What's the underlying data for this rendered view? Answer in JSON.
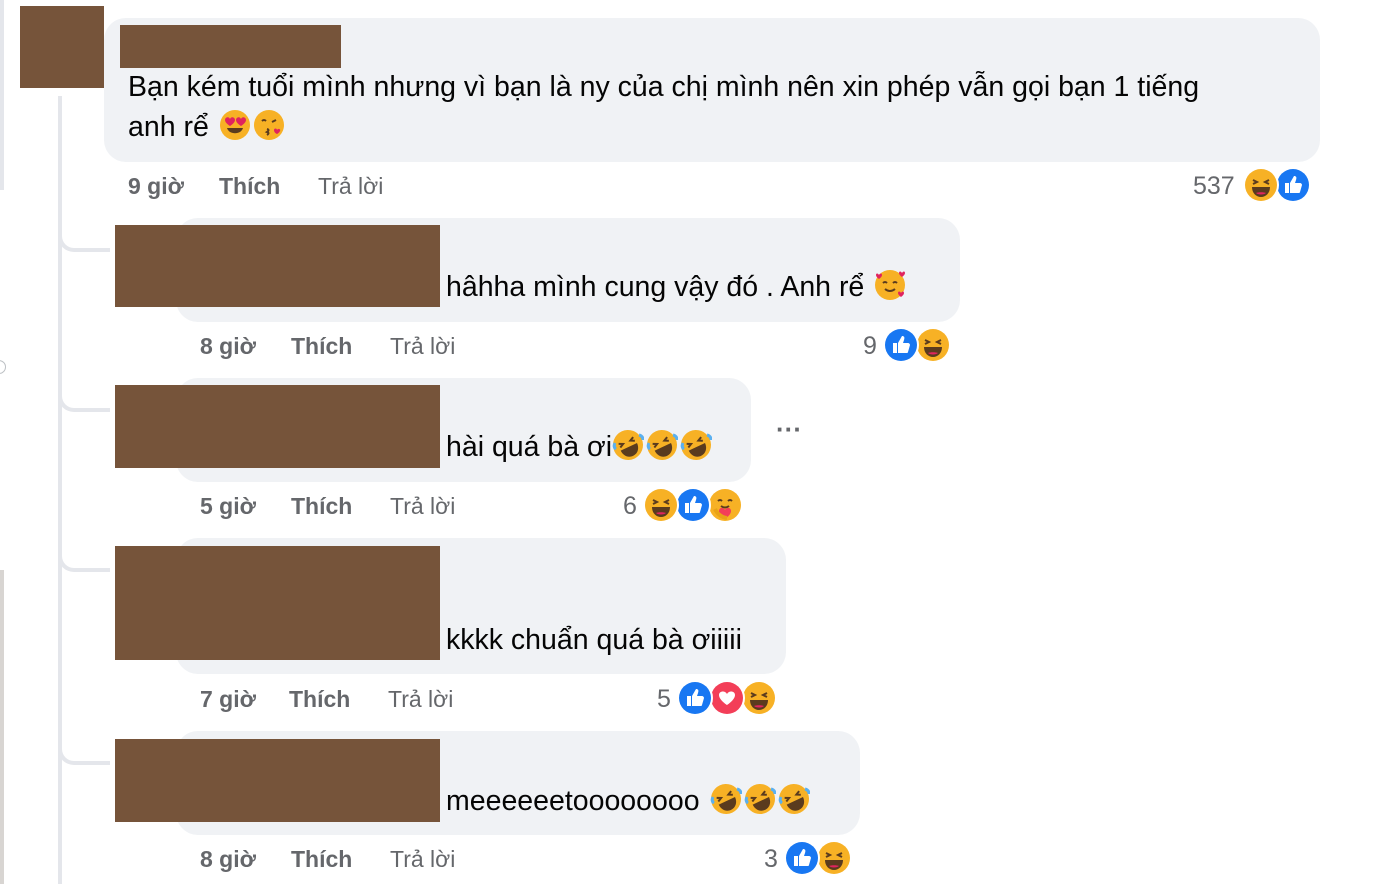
{
  "comment": {
    "text_line1": "Bạn kém tuổi mình nhưng vì bạn là ny của chị mình nên xin phép vẫn gọi bạn 1 tiếng",
    "text_line2": "anh rể",
    "emojis": [
      "heart-eyes-emoji",
      "kissing-heart-emoji"
    ],
    "time": "9 giờ",
    "like_label": "Thích",
    "reply_label": "Trả lời",
    "reaction_count": "537",
    "reactions": [
      "haha",
      "like"
    ]
  },
  "replies": [
    {
      "text": "hâhha mình cung vậy đó . Anh rể",
      "emojis": [
        "smiling-hearts-emoji"
      ],
      "time": "8 giờ",
      "like_label": "Thích",
      "reply_label": "Trả lời",
      "reaction_count": "9",
      "reactions": [
        "like",
        "haha"
      ]
    },
    {
      "text": "hài quá bà ơi",
      "emojis": [
        "rofl-emoji",
        "rofl-emoji",
        "rofl-emoji"
      ],
      "time": "5 giờ",
      "like_label": "Thích",
      "reply_label": "Trả lời",
      "reaction_count": "6",
      "reactions": [
        "haha",
        "like",
        "care"
      ]
    },
    {
      "text": "kkkk chuẩn quá bà ơiiiii",
      "emojis": [],
      "time": "7 giờ",
      "like_label": "Thích",
      "reply_label": "Trả lời",
      "reaction_count": "5",
      "reactions": [
        "like",
        "love",
        "haha"
      ]
    },
    {
      "text": "meeeeeetoooooooo",
      "emojis": [
        "rofl-emoji",
        "rofl-emoji",
        "rofl-emoji"
      ],
      "time": "8 giờ",
      "like_label": "Thích",
      "reply_label": "Trả lời",
      "reaction_count": "3",
      "reactions": [
        "like",
        "haha"
      ]
    }
  ],
  "more_options": "···",
  "colors": {
    "bubble": "#f0f2f5",
    "redaction": "#76543a",
    "meta_text": "#65676b",
    "like_blue": "#1877f2",
    "love_red": "#f33e58",
    "haha_yellow": "#f7b125"
  }
}
